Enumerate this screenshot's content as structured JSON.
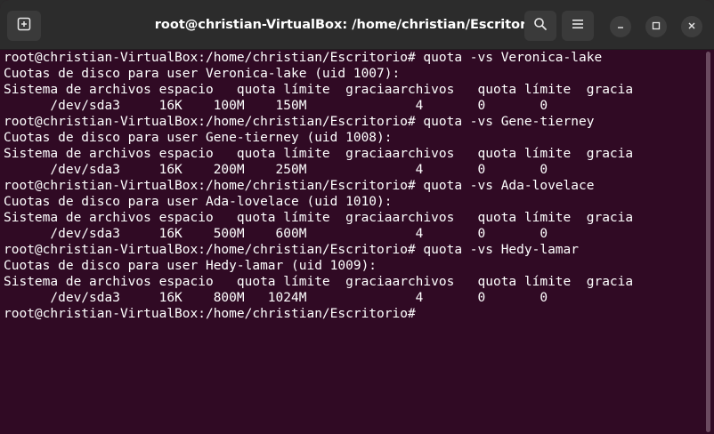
{
  "window": {
    "title": "root@christian-VirtualBox: /home/christian/Escritorio"
  },
  "icons": {
    "new_tab": "new-tab-icon",
    "search": "search-icon",
    "menu": "hamburger-menu-icon",
    "minimize": "minimize-icon",
    "maximize": "maximize-icon",
    "close": "close-icon"
  },
  "colors": {
    "terminal_bg": "#300a24",
    "titlebar_bg": "#2c2c2c",
    "text": "#ffffff"
  },
  "terminal": {
    "lines": [
      "root@christian-VirtualBox:/home/christian/Escritorio# quota -vs Veronica-lake",
      "Cuotas de disco para user Veronica-lake (uid 1007):",
      "Sistema de archivos espacio   quota límite  graciaarchivos   quota límite  gracia",
      "      /dev/sda3     16K    100M    150M              4       0       0",
      "root@christian-VirtualBox:/home/christian/Escritorio# quota -vs Gene-tierney",
      "Cuotas de disco para user Gene-tierney (uid 1008):",
      "Sistema de archivos espacio   quota límite  graciaarchivos   quota límite  gracia",
      "      /dev/sda3     16K    200M    250M              4       0       0",
      "root@christian-VirtualBox:/home/christian/Escritorio# quota -vs Ada-lovelace",
      "Cuotas de disco para user Ada-lovelace (uid 1010):",
      "Sistema de archivos espacio   quota límite  graciaarchivos   quota límite  gracia",
      "      /dev/sda3     16K    500M    600M              4       0       0",
      "root@christian-VirtualBox:/home/christian/Escritorio# quota -vs Hedy-lamar",
      "Cuotas de disco para user Hedy-lamar (uid 1009):",
      "Sistema de archivos espacio   quota límite  graciaarchivos   quota límite  gracia",
      "      /dev/sda3     16K    800M   1024M              4       0       0",
      "root@christian-VirtualBox:/home/christian/Escritorio# "
    ]
  }
}
